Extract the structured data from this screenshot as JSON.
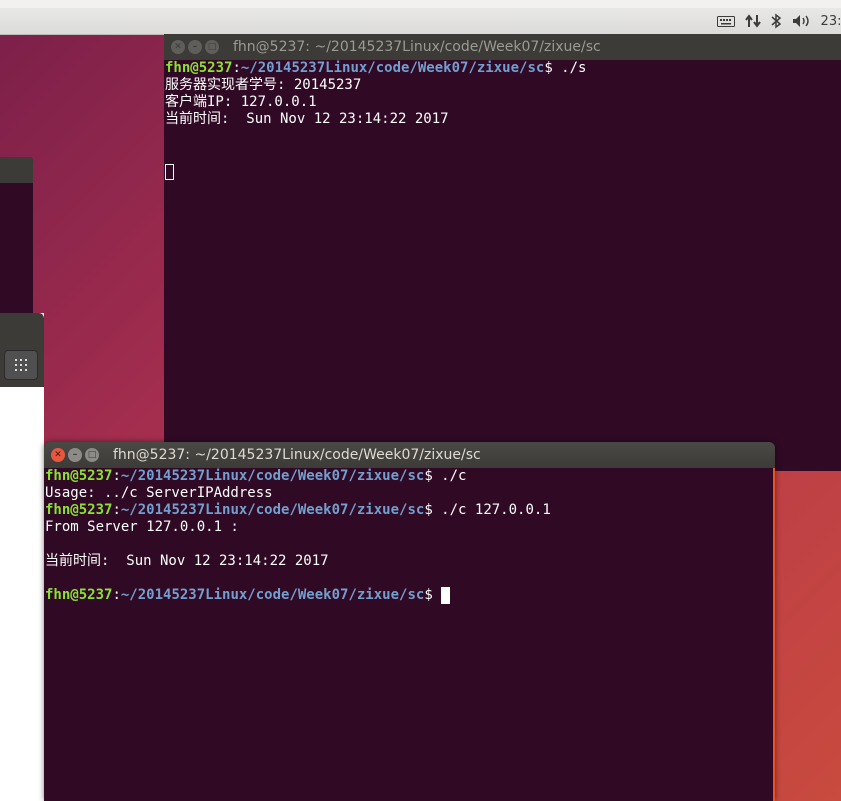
{
  "panel": {
    "indicators": [
      "keyboard-icon",
      "network-arrows-icon",
      "bluetooth-icon",
      "volume-icon"
    ],
    "clock": "23:"
  },
  "bg_window": {
    "grid_icon": "app-grid-icon"
  },
  "terminal_top": {
    "title": "fhn@5237: ~/20145237Linux/code/Week07/zixue/sc",
    "lines": [
      {
        "user": "fhn@5237",
        "path": "~/20145237Linux/code/Week07/zixue/sc",
        "cmd": "$ ./s"
      },
      {
        "text": "服务器实现者学号: 20145237"
      },
      {
        "text": "客户端IP: 127.0.0.1"
      },
      {
        "text": "当前时间:  Sun Nov 12 23:14:22 2017"
      }
    ]
  },
  "terminal_bottom": {
    "title": "fhn@5237: ~/20145237Linux/code/Week07/zixue/sc",
    "lines": [
      {
        "user": "fhn@5237",
        "path": "~/20145237Linux/code/Week07/zixue/sc",
        "cmd": "$ ./c"
      },
      {
        "text": "Usage: ../c ServerIPAddress"
      },
      {
        "user": "fhn@5237",
        "path": "~/20145237Linux/code/Week07/zixue/sc",
        "cmd": "$ ./c 127.0.0.1"
      },
      {
        "text": "From Server 127.0.0.1 :"
      },
      {
        "text": ""
      },
      {
        "text": "当前时间:  Sun Nov 12 23:14:22 2017"
      },
      {
        "text": ""
      },
      {
        "user": "fhn@5237",
        "path": "~/20145237Linux/code/Week07/zixue/sc",
        "cmd": "$ "
      }
    ]
  },
  "colors": {
    "terminal_bg": "#300a24",
    "user": "#8ae234",
    "path": "#729fcf",
    "accent": "#e95420"
  }
}
